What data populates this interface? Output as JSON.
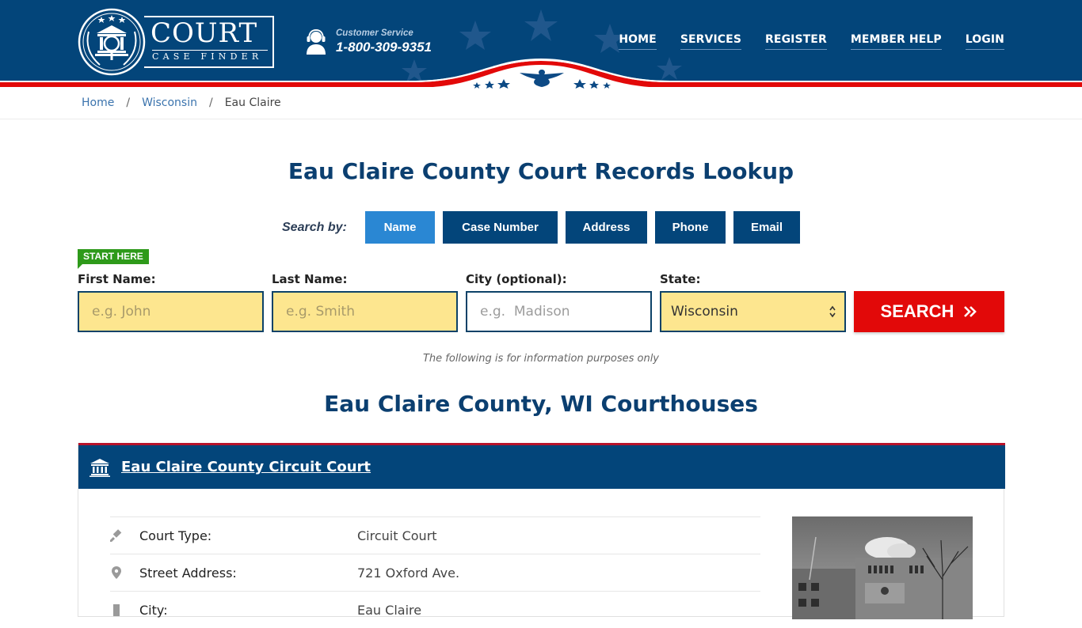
{
  "header": {
    "logo": {
      "title": "COURT",
      "subtitle": "CASE FINDER",
      "icon": "courthouse-magnifier-laurel-icon"
    },
    "customer_service": {
      "label": "Customer Service",
      "phone": "1-800-309-9351",
      "icon": "headset-agent-icon"
    },
    "nav": [
      {
        "label": "HOME"
      },
      {
        "label": "SERVICES"
      },
      {
        "label": "REGISTER"
      },
      {
        "label": "MEMBER HELP"
      },
      {
        "label": "LOGIN"
      }
    ],
    "colors": {
      "primary": "#03457a",
      "accent_red": "#e20909"
    }
  },
  "breadcrumb": [
    {
      "label": "Home",
      "link": true
    },
    {
      "label": "Wisconsin",
      "link": true
    },
    {
      "label": "Eau Claire",
      "link": false
    }
  ],
  "page_title": "Eau Claire County Court Records Lookup",
  "search": {
    "search_by_label": "Search by:",
    "tabs": [
      {
        "label": "Name",
        "active": true
      },
      {
        "label": "Case Number",
        "active": false
      },
      {
        "label": "Address",
        "active": false
      },
      {
        "label": "Phone",
        "active": false
      },
      {
        "label": "Email",
        "active": false
      }
    ],
    "start_here": "START HERE",
    "fields": {
      "first_name": {
        "label": "First Name:",
        "placeholder": "e.g. John",
        "value": ""
      },
      "last_name": {
        "label": "Last Name:",
        "placeholder": "e.g. Smith",
        "value": ""
      },
      "city": {
        "label": "City (optional):",
        "placeholder": "e.g.  Madison",
        "value": ""
      },
      "state": {
        "label": "State:",
        "value": "Wisconsin"
      }
    },
    "button_label": "SEARCH",
    "button_icon": "double-chevron-right-icon"
  },
  "info_note": "The following is for information purposes only",
  "section_title": "Eau Claire County, WI Courthouses",
  "courthouse": {
    "name": "Eau Claire County Circuit Court",
    "details": [
      {
        "icon": "gavel-icon",
        "label": "Court Type:",
        "value": "Circuit Court"
      },
      {
        "icon": "map-pin-icon",
        "label": "Street Address:",
        "value": "721 Oxford Ave."
      },
      {
        "icon": "city-building-icon",
        "label": "City:",
        "value": "Eau Claire"
      }
    ],
    "photo_alt": "Courthouse photo"
  }
}
